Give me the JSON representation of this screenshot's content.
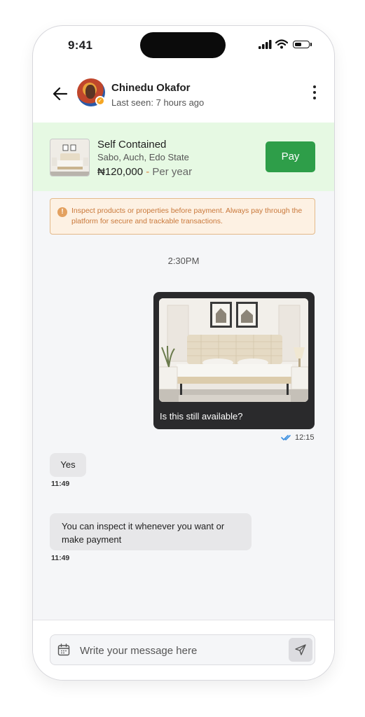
{
  "status_bar": {
    "time": "9:41"
  },
  "header": {
    "contact_name": "Chinedu Okafor",
    "last_seen": "Last seen: 7 hours ago"
  },
  "product": {
    "title": "Self Contained",
    "location": "Sabo, Auch, Edo State",
    "price": "₦120,000",
    "separator": "-",
    "period": "Per year",
    "pay_label": "Pay"
  },
  "warning": {
    "text": "Inspect products or properties before payment. Always pay through the platform for secure and trackable transactions."
  },
  "chat": {
    "date_divider": "2:30PM",
    "messages": [
      {
        "direction": "sent",
        "text": "Is this still available?",
        "time": "12:15",
        "status": "read"
      },
      {
        "direction": "received",
        "text": "Yes",
        "time": "11:49"
      },
      {
        "direction": "received",
        "text": "You can inspect it whenever you want or make payment",
        "time": "11:49"
      }
    ]
  },
  "composer": {
    "placeholder": "Write your message here"
  },
  "colors": {
    "accent_green": "#2e9e49",
    "product_bg": "#e6f9e3",
    "warning_bg": "#fdf1e3",
    "warning_text": "#c9783a",
    "sent_bubble": "#2a2a2c",
    "received_bubble": "#e7e7e9",
    "read_ticks": "#3b8fe0"
  },
  "icons": [
    "back-arrow-icon",
    "more-vertical-icon",
    "verified-icon",
    "warning-icon",
    "double-check-icon",
    "calendar-icon",
    "send-icon",
    "signal-icon",
    "wifi-icon",
    "battery-icon"
  ]
}
